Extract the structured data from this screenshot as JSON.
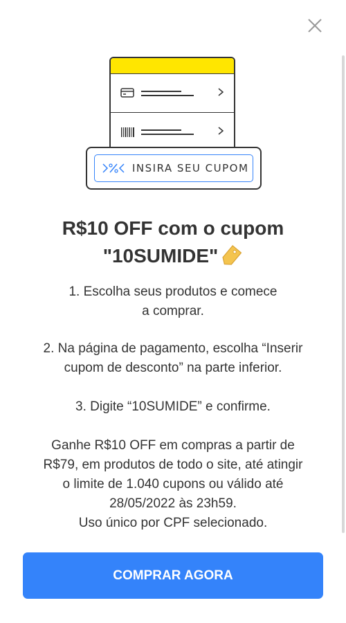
{
  "modal": {
    "close_icon": "close-icon"
  },
  "illustration": {
    "card_row_icons": [
      "credit-card-icon",
      "barcode-icon"
    ],
    "coupon_icon": "coupon-percent-icon",
    "coupon_label": "INSIRA SEU CUPOM",
    "accent_color": "#ffe600",
    "outline_color": "#3483fa"
  },
  "promo": {
    "title_line1": "R$10 OFF com o cupom",
    "title_line2": "\"10SUMIDE\"",
    "title_icon": "price-tag-icon",
    "step1_line1": "1. Escolha seus produtos e comece",
    "step1_line2": "a comprar.",
    "step2_line1": "2. Na página de pagamento, escolha “Inserir",
    "step2_line2": "cupom de desconto” na parte inferior.",
    "step3": "3. Digite “10SUMIDE” e confirme.",
    "terms_line1": "Ganhe R$10 OFF em compras a partir de",
    "terms_line2": "R$79, em produtos de todo o site, até atingir",
    "terms_line3": "o limite de 1.040 cupons ou válido até",
    "terms_line4": "28/05/2022 às 23h59.",
    "terms_line5": "Uso único por CPF selecionado."
  },
  "cta": {
    "label": "COMPRAR AGORA",
    "color": "#3483fa"
  }
}
